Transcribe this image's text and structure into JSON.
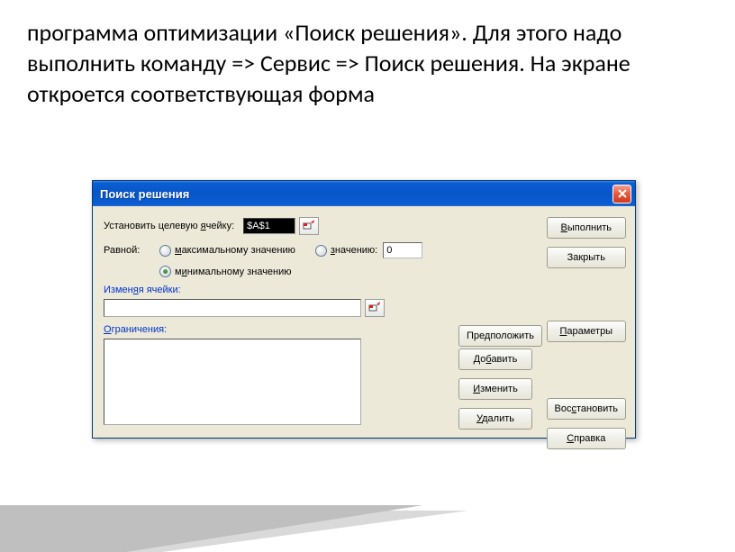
{
  "slide": {
    "text": "  программа оптимизации «Поиск решения». Для этого надо выполнить команду => Сервис => Поиск решения. На экране откроется соответствующая форма"
  },
  "dialog": {
    "title": "Поиск решения",
    "target_label_pre": "Установить целевую ",
    "target_label_u": "я",
    "target_label_post": "чейку:",
    "target_value": "$A$1",
    "equal_label": "Равной:",
    "opt_max_u": "м",
    "opt_max": "аксимальному значению",
    "opt_val_u": "з",
    "opt_val": "начению:",
    "opt_val_input": "0",
    "opt_min": "м",
    "opt_min_u": "и",
    "opt_min_post": "нимальному значению",
    "change_label_pre": "Измен",
    "change_label_u": "я",
    "change_label_post": "я ячейки:",
    "constraints_label_u": "О",
    "constraints_label": "граничения:",
    "btn_guess": "Предположить",
    "btn_add_pre": "До",
    "btn_add_u": "б",
    "btn_add_post": "авить",
    "btn_change_u": "И",
    "btn_change": "зменить",
    "btn_delete_u": "У",
    "btn_delete": "далить",
    "btn_execute_u": "В",
    "btn_execute": "ыполнить",
    "btn_close": "Закрыть",
    "btn_params_u": "П",
    "btn_params": "араметры",
    "btn_restore_pre": "Вос",
    "btn_restore_u": "с",
    "btn_restore_post": "тановить",
    "btn_help_u": "С",
    "btn_help": "правка"
  }
}
